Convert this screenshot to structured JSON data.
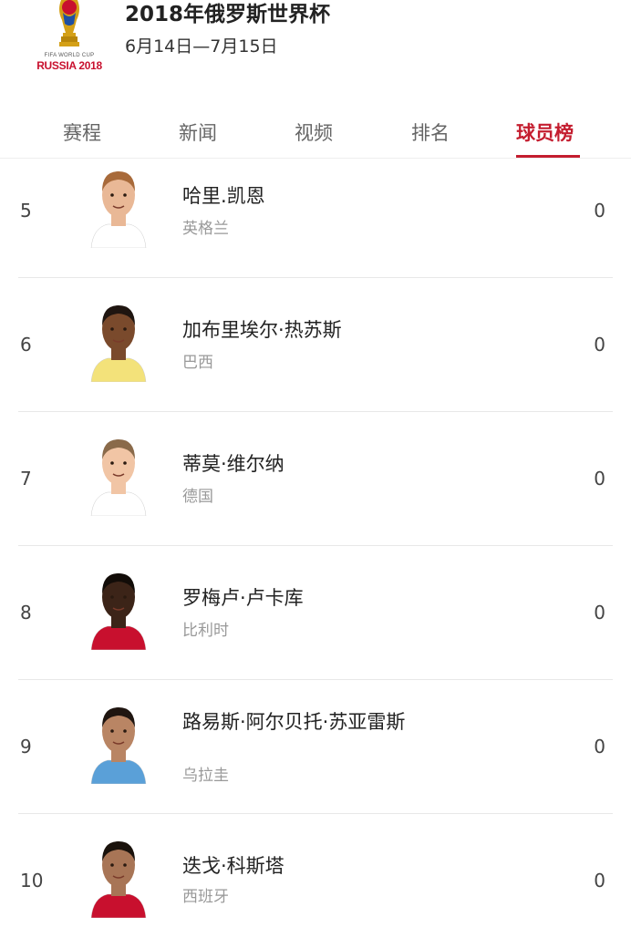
{
  "header": {
    "logo_line1": "FIFA WORLD CUP",
    "logo_line2": "RUSSIA 2018",
    "title": "2018年俄罗斯世界杯",
    "dates": "6月14日—7月15日"
  },
  "tabs": [
    {
      "label": "赛程",
      "active": false
    },
    {
      "label": "新闻",
      "active": false
    },
    {
      "label": "视频",
      "active": false
    },
    {
      "label": "排名",
      "active": false
    },
    {
      "label": "球员榜",
      "active": true
    }
  ],
  "players": [
    {
      "rank": "5",
      "name": "哈里.凯恩",
      "team": "英格兰",
      "value": "0",
      "skin": "#e9b896",
      "hair": "#a86a3a",
      "shirt": "#ffffff"
    },
    {
      "rank": "6",
      "name": "加布里埃尔·热苏斯",
      "team": "巴西",
      "value": "0",
      "skin": "#7a4a2c",
      "hair": "#1f1510",
      "shirt": "#f3e27a"
    },
    {
      "rank": "7",
      "name": "蒂莫·维尔纳",
      "team": "德国",
      "value": "0",
      "skin": "#f1c5a5",
      "hair": "#8a6a4a",
      "shirt": "#ffffff"
    },
    {
      "rank": "8",
      "name": "罗梅卢·卢卡库",
      "team": "比利时",
      "value": "0",
      "skin": "#3c2418",
      "hair": "#120c08",
      "shirt": "#c8102e"
    },
    {
      "rank": "9",
      "name": "路易斯·阿尔贝托·苏亚雷斯",
      "team": "乌拉圭",
      "value": "0",
      "skin": "#b98564",
      "hair": "#1f1510",
      "shirt": "#5aa0d8"
    },
    {
      "rank": "10",
      "name": "迭戈·科斯塔",
      "team": "西班牙",
      "value": "0",
      "skin": "#a87556",
      "hair": "#1a120c",
      "shirt": "#c8102e"
    }
  ]
}
